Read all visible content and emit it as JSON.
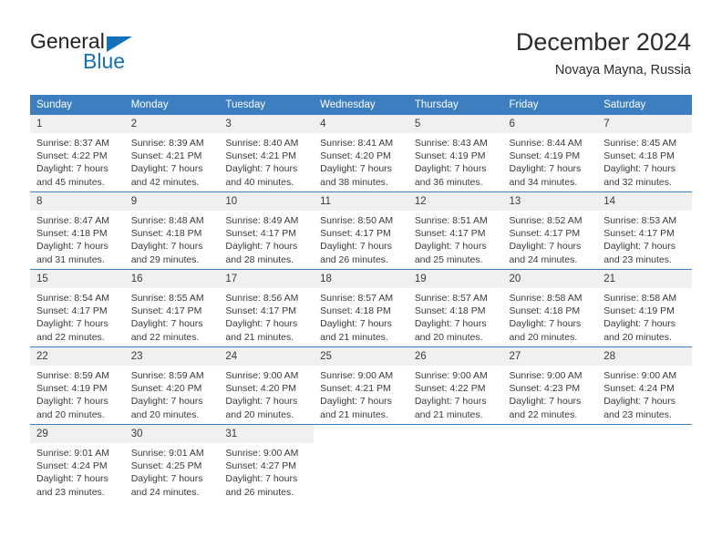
{
  "brand": {
    "name_top": "General",
    "name_bottom": "Blue",
    "triangle_icon": "triangle-icon",
    "color_dark": "#231f20",
    "color_blue": "#1470b8"
  },
  "header": {
    "title": "December 2024",
    "subtitle": "Novaya Mayna, Russia"
  },
  "theme": {
    "header_bg": "#3c7ebf",
    "header_text": "#ffffff",
    "daynum_bg": "#f0f0f0",
    "cell_bg": "#ffffff",
    "text": "#3a3a3a"
  },
  "weekdays": [
    "Sunday",
    "Monday",
    "Tuesday",
    "Wednesday",
    "Thursday",
    "Friday",
    "Saturday"
  ],
  "labels": {
    "sunrise_prefix": "Sunrise:",
    "sunset_prefix": "Sunset:",
    "daylight_prefix": "Daylight:"
  },
  "weeks": [
    [
      {
        "day": "1",
        "sunrise": "Sunrise: 8:37 AM",
        "sunset": "Sunset: 4:22 PM",
        "daylight1": "Daylight: 7 hours",
        "daylight2": "and 45 minutes."
      },
      {
        "day": "2",
        "sunrise": "Sunrise: 8:39 AM",
        "sunset": "Sunset: 4:21 PM",
        "daylight1": "Daylight: 7 hours",
        "daylight2": "and 42 minutes."
      },
      {
        "day": "3",
        "sunrise": "Sunrise: 8:40 AM",
        "sunset": "Sunset: 4:21 PM",
        "daylight1": "Daylight: 7 hours",
        "daylight2": "and 40 minutes."
      },
      {
        "day": "4",
        "sunrise": "Sunrise: 8:41 AM",
        "sunset": "Sunset: 4:20 PM",
        "daylight1": "Daylight: 7 hours",
        "daylight2": "and 38 minutes."
      },
      {
        "day": "5",
        "sunrise": "Sunrise: 8:43 AM",
        "sunset": "Sunset: 4:19 PM",
        "daylight1": "Daylight: 7 hours",
        "daylight2": "and 36 minutes."
      },
      {
        "day": "6",
        "sunrise": "Sunrise: 8:44 AM",
        "sunset": "Sunset: 4:19 PM",
        "daylight1": "Daylight: 7 hours",
        "daylight2": "and 34 minutes."
      },
      {
        "day": "7",
        "sunrise": "Sunrise: 8:45 AM",
        "sunset": "Sunset: 4:18 PM",
        "daylight1": "Daylight: 7 hours",
        "daylight2": "and 32 minutes."
      }
    ],
    [
      {
        "day": "8",
        "sunrise": "Sunrise: 8:47 AM",
        "sunset": "Sunset: 4:18 PM",
        "daylight1": "Daylight: 7 hours",
        "daylight2": "and 31 minutes."
      },
      {
        "day": "9",
        "sunrise": "Sunrise: 8:48 AM",
        "sunset": "Sunset: 4:18 PM",
        "daylight1": "Daylight: 7 hours",
        "daylight2": "and 29 minutes."
      },
      {
        "day": "10",
        "sunrise": "Sunrise: 8:49 AM",
        "sunset": "Sunset: 4:17 PM",
        "daylight1": "Daylight: 7 hours",
        "daylight2": "and 28 minutes."
      },
      {
        "day": "11",
        "sunrise": "Sunrise: 8:50 AM",
        "sunset": "Sunset: 4:17 PM",
        "daylight1": "Daylight: 7 hours",
        "daylight2": "and 26 minutes."
      },
      {
        "day": "12",
        "sunrise": "Sunrise: 8:51 AM",
        "sunset": "Sunset: 4:17 PM",
        "daylight1": "Daylight: 7 hours",
        "daylight2": "and 25 minutes."
      },
      {
        "day": "13",
        "sunrise": "Sunrise: 8:52 AM",
        "sunset": "Sunset: 4:17 PM",
        "daylight1": "Daylight: 7 hours",
        "daylight2": "and 24 minutes."
      },
      {
        "day": "14",
        "sunrise": "Sunrise: 8:53 AM",
        "sunset": "Sunset: 4:17 PM",
        "daylight1": "Daylight: 7 hours",
        "daylight2": "and 23 minutes."
      }
    ],
    [
      {
        "day": "15",
        "sunrise": "Sunrise: 8:54 AM",
        "sunset": "Sunset: 4:17 PM",
        "daylight1": "Daylight: 7 hours",
        "daylight2": "and 22 minutes."
      },
      {
        "day": "16",
        "sunrise": "Sunrise: 8:55 AM",
        "sunset": "Sunset: 4:17 PM",
        "daylight1": "Daylight: 7 hours",
        "daylight2": "and 22 minutes."
      },
      {
        "day": "17",
        "sunrise": "Sunrise: 8:56 AM",
        "sunset": "Sunset: 4:17 PM",
        "daylight1": "Daylight: 7 hours",
        "daylight2": "and 21 minutes."
      },
      {
        "day": "18",
        "sunrise": "Sunrise: 8:57 AM",
        "sunset": "Sunset: 4:18 PM",
        "daylight1": "Daylight: 7 hours",
        "daylight2": "and 21 minutes."
      },
      {
        "day": "19",
        "sunrise": "Sunrise: 8:57 AM",
        "sunset": "Sunset: 4:18 PM",
        "daylight1": "Daylight: 7 hours",
        "daylight2": "and 20 minutes."
      },
      {
        "day": "20",
        "sunrise": "Sunrise: 8:58 AM",
        "sunset": "Sunset: 4:18 PM",
        "daylight1": "Daylight: 7 hours",
        "daylight2": "and 20 minutes."
      },
      {
        "day": "21",
        "sunrise": "Sunrise: 8:58 AM",
        "sunset": "Sunset: 4:19 PM",
        "daylight1": "Daylight: 7 hours",
        "daylight2": "and 20 minutes."
      }
    ],
    [
      {
        "day": "22",
        "sunrise": "Sunrise: 8:59 AM",
        "sunset": "Sunset: 4:19 PM",
        "daylight1": "Daylight: 7 hours",
        "daylight2": "and 20 minutes."
      },
      {
        "day": "23",
        "sunrise": "Sunrise: 8:59 AM",
        "sunset": "Sunset: 4:20 PM",
        "daylight1": "Daylight: 7 hours",
        "daylight2": "and 20 minutes."
      },
      {
        "day": "24",
        "sunrise": "Sunrise: 9:00 AM",
        "sunset": "Sunset: 4:20 PM",
        "daylight1": "Daylight: 7 hours",
        "daylight2": "and 20 minutes."
      },
      {
        "day": "25",
        "sunrise": "Sunrise: 9:00 AM",
        "sunset": "Sunset: 4:21 PM",
        "daylight1": "Daylight: 7 hours",
        "daylight2": "and 21 minutes."
      },
      {
        "day": "26",
        "sunrise": "Sunrise: 9:00 AM",
        "sunset": "Sunset: 4:22 PM",
        "daylight1": "Daylight: 7 hours",
        "daylight2": "and 21 minutes."
      },
      {
        "day": "27",
        "sunrise": "Sunrise: 9:00 AM",
        "sunset": "Sunset: 4:23 PM",
        "daylight1": "Daylight: 7 hours",
        "daylight2": "and 22 minutes."
      },
      {
        "day": "28",
        "sunrise": "Sunrise: 9:00 AM",
        "sunset": "Sunset: 4:24 PM",
        "daylight1": "Daylight: 7 hours",
        "daylight2": "and 23 minutes."
      }
    ],
    [
      {
        "day": "29",
        "sunrise": "Sunrise: 9:01 AM",
        "sunset": "Sunset: 4:24 PM",
        "daylight1": "Daylight: 7 hours",
        "daylight2": "and 23 minutes."
      },
      {
        "day": "30",
        "sunrise": "Sunrise: 9:01 AM",
        "sunset": "Sunset: 4:25 PM",
        "daylight1": "Daylight: 7 hours",
        "daylight2": "and 24 minutes."
      },
      {
        "day": "31",
        "sunrise": "Sunrise: 9:00 AM",
        "sunset": "Sunset: 4:27 PM",
        "daylight1": "Daylight: 7 hours",
        "daylight2": "and 26 minutes."
      },
      {
        "day": "",
        "sunrise": "",
        "sunset": "",
        "daylight1": "",
        "daylight2": ""
      },
      {
        "day": "",
        "sunrise": "",
        "sunset": "",
        "daylight1": "",
        "daylight2": ""
      },
      {
        "day": "",
        "sunrise": "",
        "sunset": "",
        "daylight1": "",
        "daylight2": ""
      },
      {
        "day": "",
        "sunrise": "",
        "sunset": "",
        "daylight1": "",
        "daylight2": ""
      }
    ]
  ]
}
